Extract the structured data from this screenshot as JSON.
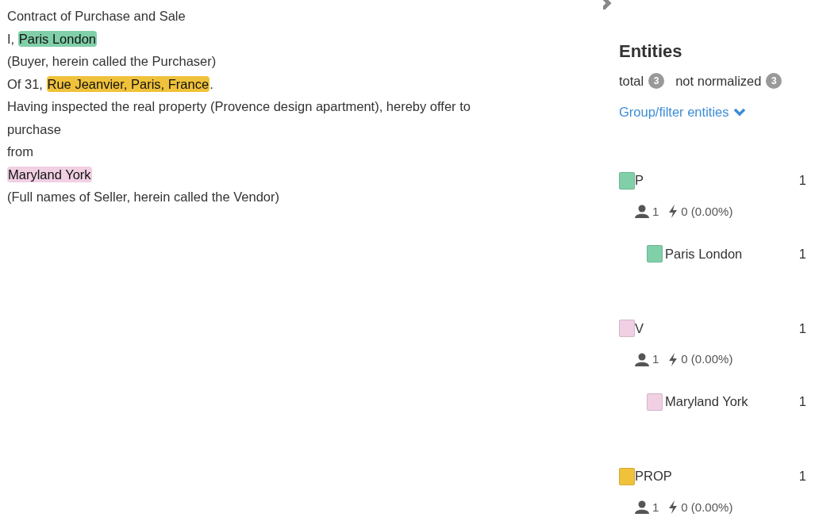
{
  "document": {
    "lines": [
      [
        {
          "text": "Contract of Purchase and Sale"
        }
      ],
      [
        {
          "text": "I, "
        },
        {
          "text": "Paris London",
          "color": "#80cfa9"
        }
      ],
      [
        {
          "text": "(Buyer, herein called the Purchaser)"
        }
      ],
      [
        {
          "text": "Of 31, "
        },
        {
          "text": "Rue Jeanvier, Paris, France",
          "color": "#f0c23b"
        },
        {
          "text": "."
        }
      ],
      [
        {
          "text": "Having inspected the real property (Provence design apartment), hereby offer to"
        }
      ],
      [
        {
          "text": "purchase"
        }
      ],
      [
        {
          "text": "from"
        }
      ],
      [
        {
          "text": "Maryland York",
          "color": "#f1d0e4"
        }
      ],
      [
        {
          "text": "(Full names of Seller, herein called the Vendor)"
        }
      ]
    ]
  },
  "entities": {
    "title": "Entities",
    "total_label": "total",
    "total": "3",
    "not_normalized_label": "not normalized",
    "not_normalized": "3",
    "group_filter": "Group/filter entities",
    "groups": [
      {
        "label": "P",
        "color": "#80cfa9",
        "count": "1",
        "users": "1",
        "auto": "0 (0.00%)",
        "children": [
          {
            "name": "Paris London",
            "color": "#80cfa9",
            "count": "1"
          }
        ]
      },
      {
        "label": "V",
        "color": "#f1d0e4",
        "count": "1",
        "users": "1",
        "auto": "0 (0.00%)",
        "children": [
          {
            "name": "Maryland York",
            "color": "#f1d0e4",
            "count": "1"
          }
        ]
      },
      {
        "label": "PROP",
        "color": "#f0c23b",
        "count": "1",
        "users": "1",
        "auto": "0 (0.00%)"
      }
    ]
  }
}
